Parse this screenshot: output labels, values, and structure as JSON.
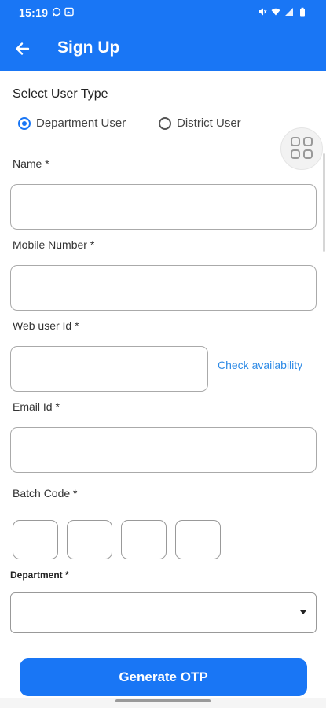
{
  "status_bar": {
    "time": "15:19",
    "left_icons": [
      "whatsapp-icon",
      "gallery-icon"
    ],
    "right_icons": [
      "mute-icon",
      "wifi-icon",
      "signal-icon",
      "battery-icon"
    ]
  },
  "app_bar": {
    "title": "Sign Up",
    "back_icon": "arrow-left-icon",
    "color": "#1976f5"
  },
  "form": {
    "user_type": {
      "label": "Select User Type",
      "options": [
        {
          "label": "Department User",
          "selected": true
        },
        {
          "label": "District User",
          "selected": false
        }
      ]
    },
    "name": {
      "label": "Name *",
      "value": ""
    },
    "mobile": {
      "label": "Mobile Number *",
      "value": ""
    },
    "web_user_id": {
      "label": "Web user Id *",
      "value": "",
      "check_link": "Check availability"
    },
    "email": {
      "label": "Email Id  *",
      "value": ""
    },
    "batch_code": {
      "label": "Batch Code  *",
      "digits": [
        "",
        "",
        "",
        ""
      ]
    },
    "department": {
      "label": "Department *",
      "selected": ""
    },
    "submit_label": "Generate OTP"
  },
  "floating_button": {
    "icon": "grid-icon"
  }
}
